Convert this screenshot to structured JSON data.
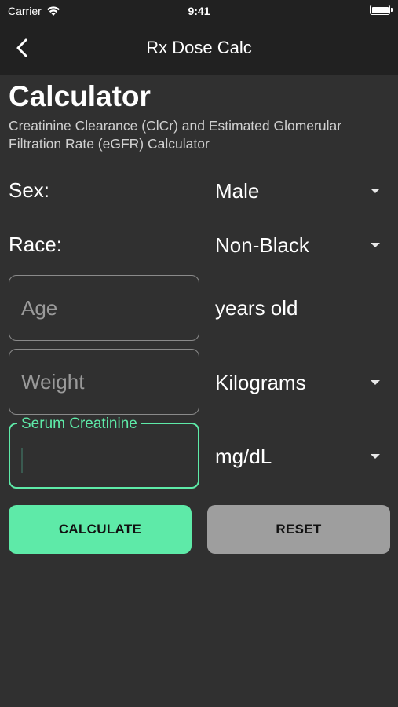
{
  "status_bar": {
    "carrier": "Carrier",
    "time": "9:41"
  },
  "nav": {
    "title": "Rx Dose Calc"
  },
  "page": {
    "title": "Calculator",
    "subtitle": "Creatinine Clearance (ClCr) and Estimated Glomerular Filtration Rate (eGFR) Calculator"
  },
  "form": {
    "sex": {
      "label": "Sex:",
      "value": "Male"
    },
    "race": {
      "label": "Race:",
      "value": "Non-Black"
    },
    "age": {
      "placeholder": "Age",
      "unit": "years old"
    },
    "weight": {
      "placeholder": "Weight",
      "unit": "Kilograms"
    },
    "serum_creatinine": {
      "label": "Serum Creatinine",
      "value": "",
      "unit": "mg/dL"
    }
  },
  "buttons": {
    "calculate": "CALCULATE",
    "reset": "RESET"
  },
  "colors": {
    "accent": "#5eeaa8",
    "background": "#303030",
    "bar": "#212121",
    "reset_button": "#9e9e9e"
  },
  "icons": {
    "back": "chevron-left-icon",
    "dropdown": "caret-down-icon",
    "wifi": "wifi-icon",
    "battery": "battery-icon"
  }
}
